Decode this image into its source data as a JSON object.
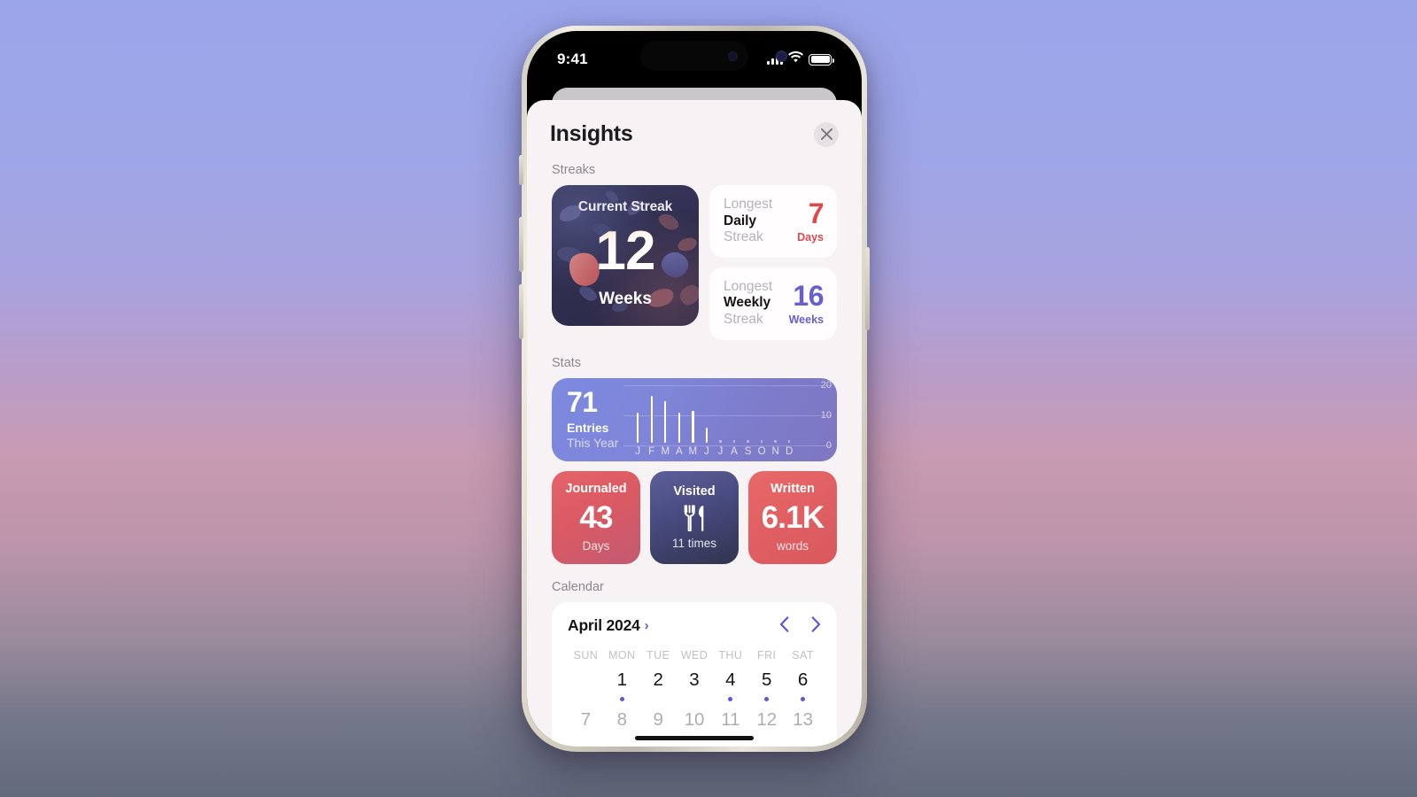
{
  "status_bar": {
    "time": "9:41",
    "signal_icon": "cellular-bars-icon",
    "wifi_icon": "wifi-icon",
    "battery_icon": "battery-full-icon"
  },
  "sheet": {
    "title": "Insights",
    "close_label": "close-icon"
  },
  "sections": {
    "streaks": "Streaks",
    "stats": "Stats",
    "calendar": "Calendar"
  },
  "current_streak": {
    "title": "Current Streak",
    "value": "12",
    "unit": "Weeks"
  },
  "longest_daily": {
    "line1": "Longest",
    "line2": "Daily",
    "line3": "Streak",
    "value": "7",
    "unit": "Days",
    "color": "#e0484a"
  },
  "longest_weekly": {
    "line1": "Longest",
    "line2": "Weekly",
    "line3": "Streak",
    "value": "16",
    "unit": "Weeks",
    "color": "#6660cf"
  },
  "entries": {
    "value": "71",
    "label1": "Entries",
    "label2": "This Year"
  },
  "tiles": [
    {
      "top": "Journaled",
      "big": "43",
      "bottom": "Days",
      "icon": null
    },
    {
      "top": "Visited",
      "big": "",
      "bottom": "11 times",
      "icon": "fork-knife-icon"
    },
    {
      "top": "Written",
      "big": "6.1K",
      "bottom": "words",
      "icon": null
    }
  ],
  "calendar": {
    "month": "April 2024",
    "month_chevron": "chevron-right-icon",
    "prev_label": "chevron-left-icon",
    "next_label": "chevron-right-icon",
    "day_headers": [
      "SUN",
      "MON",
      "TUE",
      "WED",
      "THU",
      "FRI",
      "SAT"
    ],
    "weeks": [
      {
        "days": [
          "",
          "1",
          "2",
          "3",
          "4",
          "5",
          "6"
        ],
        "dots": [
          false,
          true,
          false,
          false,
          true,
          true,
          true
        ]
      },
      {
        "days": [
          "7",
          "8",
          "9",
          "10",
          "11",
          "12",
          "13"
        ],
        "dots": [
          false,
          false,
          false,
          false,
          false,
          false,
          false
        ]
      }
    ]
  },
  "chart_data": {
    "type": "bar",
    "title": "Entries This Year",
    "categories": [
      "J",
      "F",
      "M",
      "A",
      "M",
      "J",
      "J",
      "A",
      "S",
      "O",
      "N",
      "D"
    ],
    "values": [
      12,
      19,
      17,
      12,
      13,
      6,
      0,
      0,
      0,
      0,
      0,
      0
    ],
    "xlabel": "",
    "ylabel": "",
    "ylim": [
      0,
      20
    ],
    "yticks": [
      0,
      10,
      20
    ],
    "grid": true,
    "legend": "none",
    "series_color": "#ffffff"
  },
  "colors": {
    "accent": "#5b56d6",
    "red": "#e0484a",
    "purple": "#6660cf",
    "sheet_bg": "#f7f3f4"
  }
}
